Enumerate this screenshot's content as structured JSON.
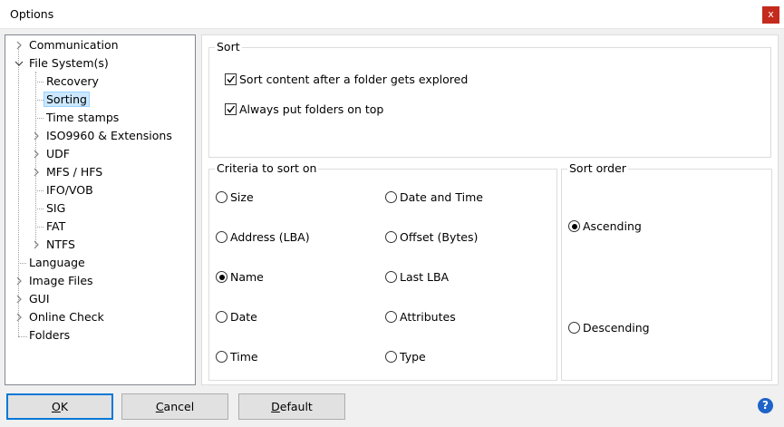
{
  "window": {
    "title": "Options",
    "close_glyph": "x"
  },
  "tree": {
    "items": [
      {
        "label": "Communication",
        "expander": "collapsed"
      },
      {
        "label": "File System(s)",
        "expander": "expanded"
      },
      {
        "label": "Recovery"
      },
      {
        "label": "Sorting",
        "selected": true
      },
      {
        "label": "Time stamps"
      },
      {
        "label": "ISO9960 & Extensions",
        "expander": "collapsed"
      },
      {
        "label": "UDF",
        "expander": "collapsed"
      },
      {
        "label": "MFS / HFS",
        "expander": "collapsed"
      },
      {
        "label": "IFO/VOB"
      },
      {
        "label": "SIG"
      },
      {
        "label": "FAT"
      },
      {
        "label": "NTFS",
        "expander": "collapsed"
      },
      {
        "label": "Language"
      },
      {
        "label": "Image Files",
        "expander": "collapsed"
      },
      {
        "label": "GUI",
        "expander": "collapsed"
      },
      {
        "label": "Online Check",
        "expander": "collapsed"
      },
      {
        "label": "Folders"
      }
    ]
  },
  "sort": {
    "title": "Sort",
    "options": [
      {
        "label": "Sort content after a folder gets explored",
        "checked": true
      },
      {
        "label": "Always put folders on top",
        "checked": true
      }
    ]
  },
  "criteria": {
    "title": "Criteria to sort on",
    "left": [
      {
        "label": "Size",
        "checked": false
      },
      {
        "label": "Address (LBA)",
        "checked": false
      },
      {
        "label": "Name",
        "checked": true
      },
      {
        "label": "Date",
        "checked": false
      },
      {
        "label": "Time",
        "checked": false
      }
    ],
    "right": [
      {
        "label": "Date and Time",
        "checked": false
      },
      {
        "label": "Offset (Bytes)",
        "checked": false
      },
      {
        "label": "Last LBA",
        "checked": false
      },
      {
        "label": "Attributes",
        "checked": false
      },
      {
        "label": "Type",
        "checked": false
      }
    ]
  },
  "sort_order": {
    "title": "Sort order",
    "options": [
      {
        "label": "Ascending",
        "checked": true
      },
      {
        "label": "Descending",
        "checked": false
      }
    ]
  },
  "buttons": {
    "ok": {
      "accel": "O",
      "rest": "K"
    },
    "cancel": {
      "accel": "C",
      "rest": "ancel"
    },
    "default": {
      "accel": "D",
      "rest": "efault"
    }
  },
  "help": {
    "glyph": "?"
  },
  "colors": {
    "selection": "#cce8ff",
    "accent": "#0078d7",
    "close": "#c42b1c"
  }
}
